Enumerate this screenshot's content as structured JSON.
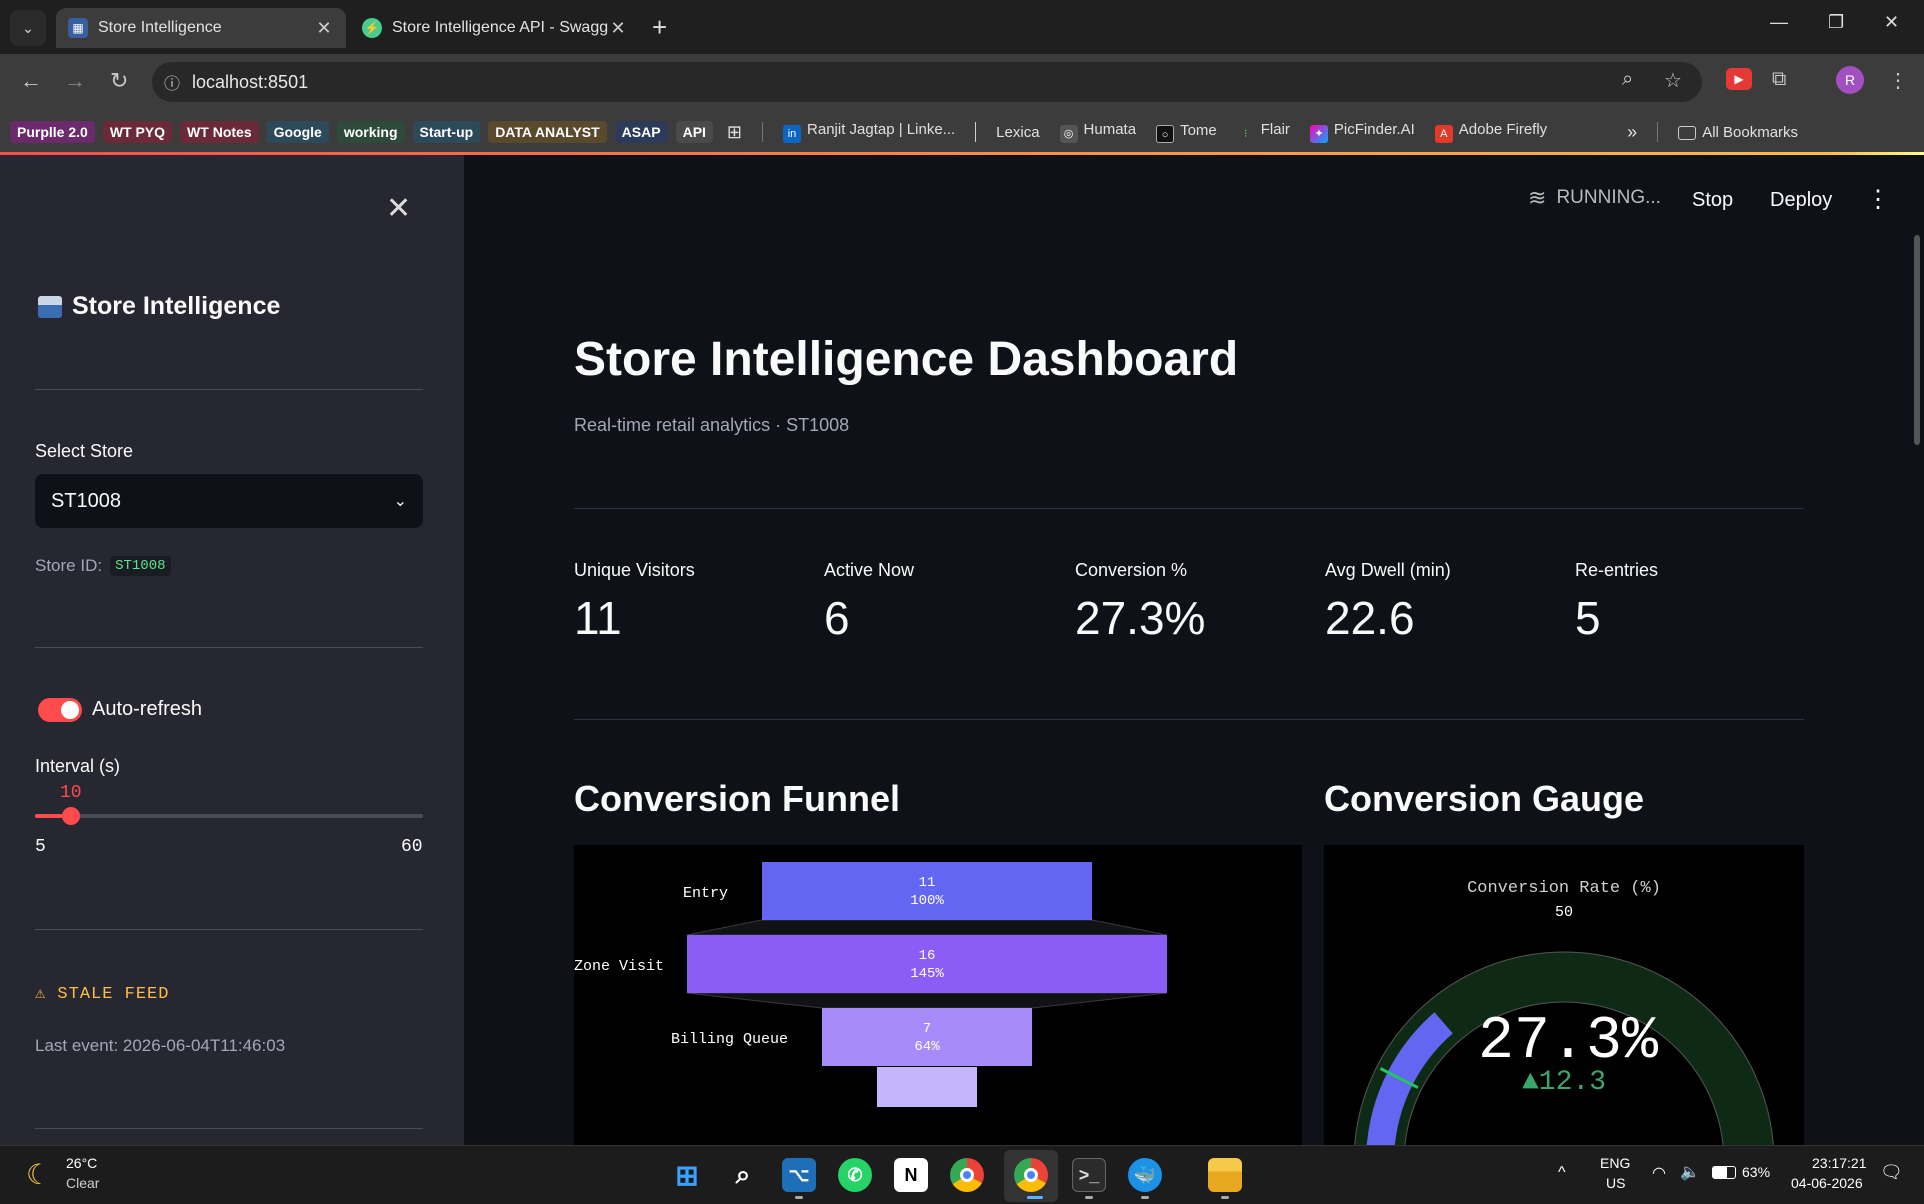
{
  "browser": {
    "tabs": [
      {
        "title": "Store Intelligence",
        "active": true
      },
      {
        "title": "Store Intelligence API - Swagge",
        "active": false
      }
    ],
    "url": "localhost:8501",
    "bookmarks": [
      "Purplle 2.0",
      "WT PYQ",
      "WT Notes",
      "Google",
      "working",
      "Start-up",
      "DATA ANALYST",
      "ASAP",
      "API"
    ],
    "bookmark_links": [
      "Ranjit Jagtap | Linke...",
      "Lexica",
      "Humata",
      "Tome",
      "Flair",
      "PicFinder.AI",
      "Adobe Firefly"
    ],
    "all_bookmarks": "All Bookmarks",
    "profile_initial": "R",
    "more": "»"
  },
  "sidebar": {
    "app_title": "Store Intelligence",
    "select_label": "Select Store",
    "selected_store": "ST1008",
    "store_id_label": "Store ID:",
    "store_id_value": "ST1008",
    "auto_refresh_label": "Auto-refresh",
    "auto_refresh_on": true,
    "interval_label": "Interval (s)",
    "interval_value": "10",
    "interval_min": "5",
    "interval_max": "60",
    "stale_feed": "⚠ STALE FEED",
    "last_event": "Last event: 2026-06-04T11:46:03"
  },
  "header": {
    "running": "RUNNING...",
    "stop": "Stop",
    "deploy": "Deploy"
  },
  "main": {
    "title": "Store Intelligence Dashboard",
    "subtitle": "Real-time retail analytics · ST1008",
    "metrics": [
      {
        "label": "Unique Visitors",
        "value": "11"
      },
      {
        "label": "Active Now",
        "value": "6"
      },
      {
        "label": "Conversion %",
        "value": "27.3%"
      },
      {
        "label": "Avg Dwell (min)",
        "value": "22.6"
      },
      {
        "label": "Re-entries",
        "value": "5"
      }
    ],
    "funnel_title": "Conversion Funnel",
    "gauge_title": "Conversion Gauge"
  },
  "chart_data": [
    {
      "type": "bar",
      "subtype": "funnel",
      "categories": [
        "Entry",
        "Zone Visit",
        "Billing Queue"
      ],
      "values": [
        11,
        16,
        7
      ],
      "percent_labels": [
        "100%",
        "145%",
        "64%"
      ],
      "colors": [
        "#6366f1",
        "#8b5cf6",
        "#a78bfa"
      ],
      "partially_visible": true
    },
    {
      "type": "gauge",
      "title": "Conversion Rate (%)",
      "value": 27.3,
      "value_label": "27.3%",
      "delta_label": "▲12.3",
      "tick_label_visible": "50",
      "range": [
        0,
        100
      ],
      "bar_color": "#6366f1",
      "track_color": "#0f2a14",
      "delta_color": "#3ca66a",
      "threshold": 15
    }
  ],
  "taskbar": {
    "weather_temp": "26°C",
    "weather_desc": "Clear",
    "lang": "ENG",
    "region": "US",
    "battery": "63%",
    "time": "23:17:21",
    "date": "04-06-2026"
  }
}
